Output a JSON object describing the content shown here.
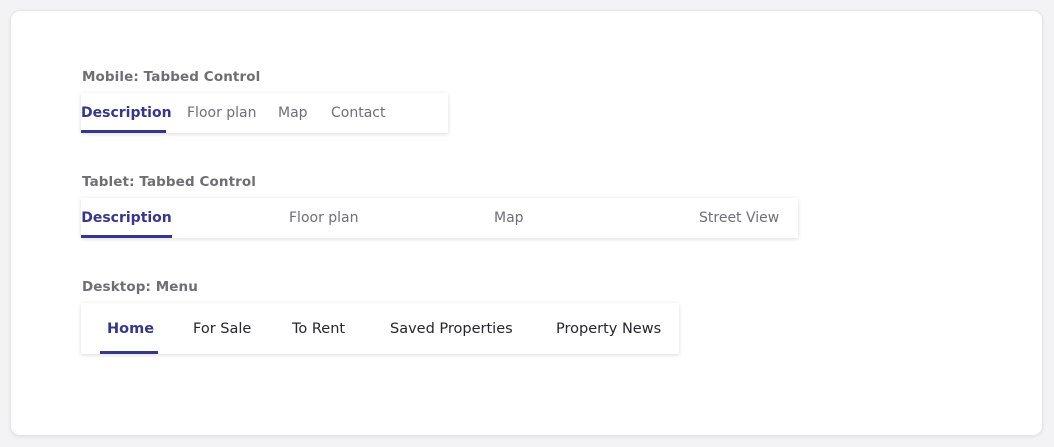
{
  "accent_color": "#36378c",
  "mobile": {
    "label": "Mobile: Tabbed Control",
    "tabs": [
      "Description",
      "Floor plan",
      "Map",
      "Contact"
    ],
    "active_index": 0
  },
  "tablet": {
    "label": "Tablet: Tabbed Control",
    "tabs": [
      "Description",
      "Floor plan",
      "Map",
      "Street View"
    ],
    "active_index": 0
  },
  "desktop": {
    "label": "Desktop: Menu",
    "items": [
      "Home",
      "For Sale",
      "To Rent",
      "Saved Properties",
      "Property News"
    ],
    "active_index": 0
  }
}
